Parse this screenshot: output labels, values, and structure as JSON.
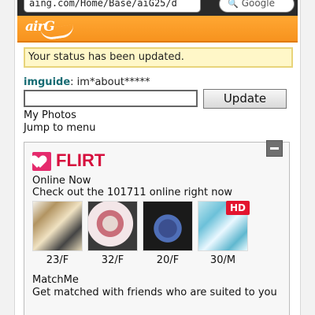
{
  "browser": {
    "url": "aing.com/Home/Base/aiG25/d",
    "search_engine": "Google"
  },
  "app": {
    "logo_text": "airG",
    "brand_color": "#f7931e"
  },
  "status": {
    "message": "Your status has been updated."
  },
  "imguide": {
    "label": "imguide",
    "text": ": im*about*****"
  },
  "status_input": {
    "value": "",
    "placeholder": ""
  },
  "buttons": {
    "update": "Update"
  },
  "links": {
    "my_photos": "My Photos",
    "jump_to_menu": "Jump to menu"
  },
  "flirt": {
    "title": "FLIRT",
    "online_now": "Online Now",
    "checkout": "Check out the 101711 online right now",
    "photos": [
      {
        "caption": "23/F"
      },
      {
        "caption": "32/F"
      },
      {
        "caption": "20/F"
      },
      {
        "caption": "30/M"
      }
    ],
    "hd_badge": "HD"
  },
  "matchme": {
    "title": "MatchMe",
    "desc": "Get matched with friends who are suited to you"
  }
}
